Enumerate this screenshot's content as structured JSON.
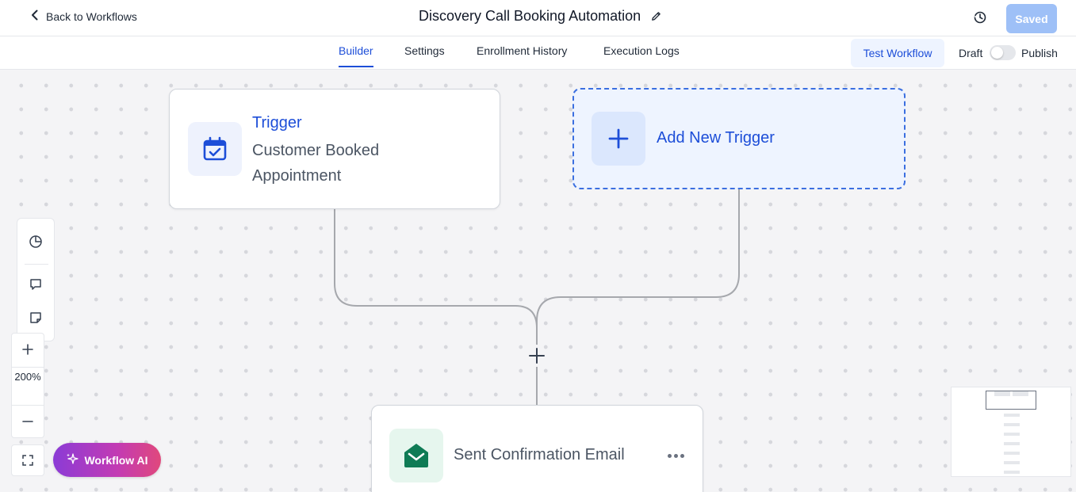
{
  "header": {
    "back_label": "Back to Workflows",
    "title": "Discovery Call Booking Automation",
    "saved_label": "Saved"
  },
  "tabs": [
    {
      "label": "Builder",
      "active": true
    },
    {
      "label": "Settings",
      "active": false
    },
    {
      "label": "Enrollment History",
      "active": false
    },
    {
      "label": "Execution Logs",
      "active": false
    }
  ],
  "actions": {
    "test_label": "Test Workflow",
    "draft_label": "Draft",
    "publish_label": "Publish",
    "published": false
  },
  "canvas": {
    "trigger_node": {
      "title": "Trigger",
      "description": "Customer Booked Appointment",
      "icon": "calendar-check-icon"
    },
    "add_trigger": {
      "label": "Add New Trigger",
      "icon": "plus-icon"
    },
    "action_node": {
      "label": "Sent Confirmation Email",
      "icon": "email-envelope-icon"
    }
  },
  "zoom": {
    "level": "200%"
  },
  "ai_button": {
    "label": "Workflow AI"
  },
  "colors": {
    "accent": "#1d4ed8",
    "saved_button": "#9ec0f7",
    "email_icon": "#0f7b55",
    "ai_gradient_start": "#8b3bd6",
    "ai_gradient_end": "#e0487c"
  }
}
